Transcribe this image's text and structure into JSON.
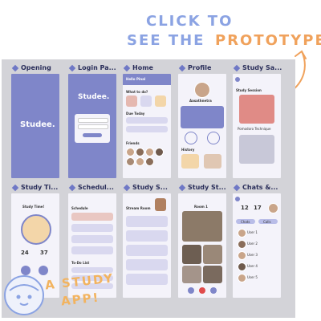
{
  "cta": {
    "line1": "CLICK TO",
    "line2": "SEE THE",
    "word": "PROTOTYPE"
  },
  "frames": {
    "opening": "Opening",
    "login": "Login Pa...",
    "home": "Home",
    "profile": "Profile",
    "study_sa": "Study Sa...",
    "study_ti": "Study Ti...",
    "schedule": "Schedul...",
    "study_s1": "Study S...",
    "study_s2": "Study St...",
    "chats": "Chats &..."
  },
  "opening": {
    "logo": "Studee."
  },
  "login": {
    "logo": "Studee."
  },
  "home": {
    "greeting": "Hello Pinal",
    "what_to_do": "What to do?",
    "due_today": "Due Today",
    "friends": "Friends"
  },
  "profile": {
    "name": "Aasathnetra",
    "history": "History"
  },
  "study_sa": {
    "title": "Study Session",
    "subtitle": "Pomodoro Technique"
  },
  "study_ti": {
    "title": "Study Time!",
    "min": "24",
    "sec": "37"
  },
  "schedule": {
    "title": "Schedule",
    "todo": "To-Do List"
  },
  "study_s1": {
    "title": "Stream Room"
  },
  "study_s2": {
    "title": "Room 1"
  },
  "chats": {
    "d1": "12",
    "d2": "17",
    "tab1": "Chats",
    "tab2": "Calls",
    "users": [
      "User 1",
      "User 2",
      "User 3",
      "User 4",
      "User 5"
    ]
  },
  "badge": {
    "line1": "A STUDY",
    "line2": "APP!"
  },
  "colors": {
    "accent_blue": "#8ba3e3",
    "accent_orange": "#f0a25c",
    "brand_purple": "#7f86c9"
  }
}
